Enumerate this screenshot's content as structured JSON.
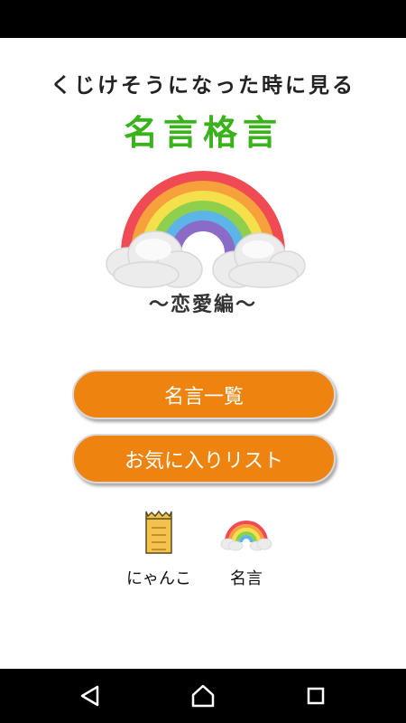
{
  "header": {
    "subtitle": "くじけそうになった時に見る",
    "title": "名言格言",
    "edition": "〜恋愛編〜",
    "hero_icon": "rainbow-with-clouds"
  },
  "menu": {
    "list_label": "名言一覧",
    "favorites_label": "お気に入りリスト"
  },
  "tabs": [
    {
      "label": "にゃんこ",
      "icon": "cat-paw-icon"
    },
    {
      "label": "名言",
      "icon": "rainbow-icon"
    }
  ],
  "nav": {
    "back_icon": "back-triangle",
    "home_icon": "home",
    "recent_icon": "recent-square"
  },
  "colors": {
    "accent": "#ee8310",
    "title": "#3ab21c"
  }
}
